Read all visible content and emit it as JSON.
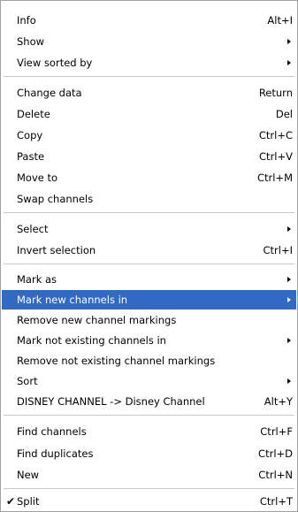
{
  "menu": {
    "highlight_color": "#316ac5",
    "items": [
      {
        "label": "Info",
        "shortcut": "Alt+I"
      },
      {
        "label": "Show",
        "submenu": true
      },
      {
        "label": "View sorted by",
        "submenu": true
      },
      {
        "label": "Change data",
        "shortcut": "Return"
      },
      {
        "label": "Delete",
        "shortcut": "Del"
      },
      {
        "label": "Copy",
        "shortcut": "Ctrl+C"
      },
      {
        "label": "Paste",
        "shortcut": "Ctrl+V"
      },
      {
        "label": "Move to",
        "shortcut": "Ctrl+M"
      },
      {
        "label": "Swap channels"
      },
      {
        "label": "Select",
        "submenu": true
      },
      {
        "label": "Invert selection",
        "shortcut": "Ctrl+I"
      },
      {
        "label": "Mark as",
        "submenu": true
      },
      {
        "label": "Mark new channels in",
        "submenu": true,
        "highlighted": true
      },
      {
        "label": "Remove new channel markings"
      },
      {
        "label": "Mark not existing channels in",
        "submenu": true
      },
      {
        "label": "Remove not existing channel markings"
      },
      {
        "label": "Sort",
        "submenu": true
      },
      {
        "label": "DISNEY CHANNEL -> Disney Channel",
        "shortcut": "Alt+Y"
      },
      {
        "label": "Find channels",
        "shortcut": "Ctrl+F"
      },
      {
        "label": "Find duplicates",
        "shortcut": "Ctrl+D"
      },
      {
        "label": "New",
        "shortcut": "Ctrl+N"
      },
      {
        "label": "Split",
        "shortcut": "Ctrl+T",
        "checked": true,
        "check_icon": "checkmark-icon"
      }
    ]
  }
}
